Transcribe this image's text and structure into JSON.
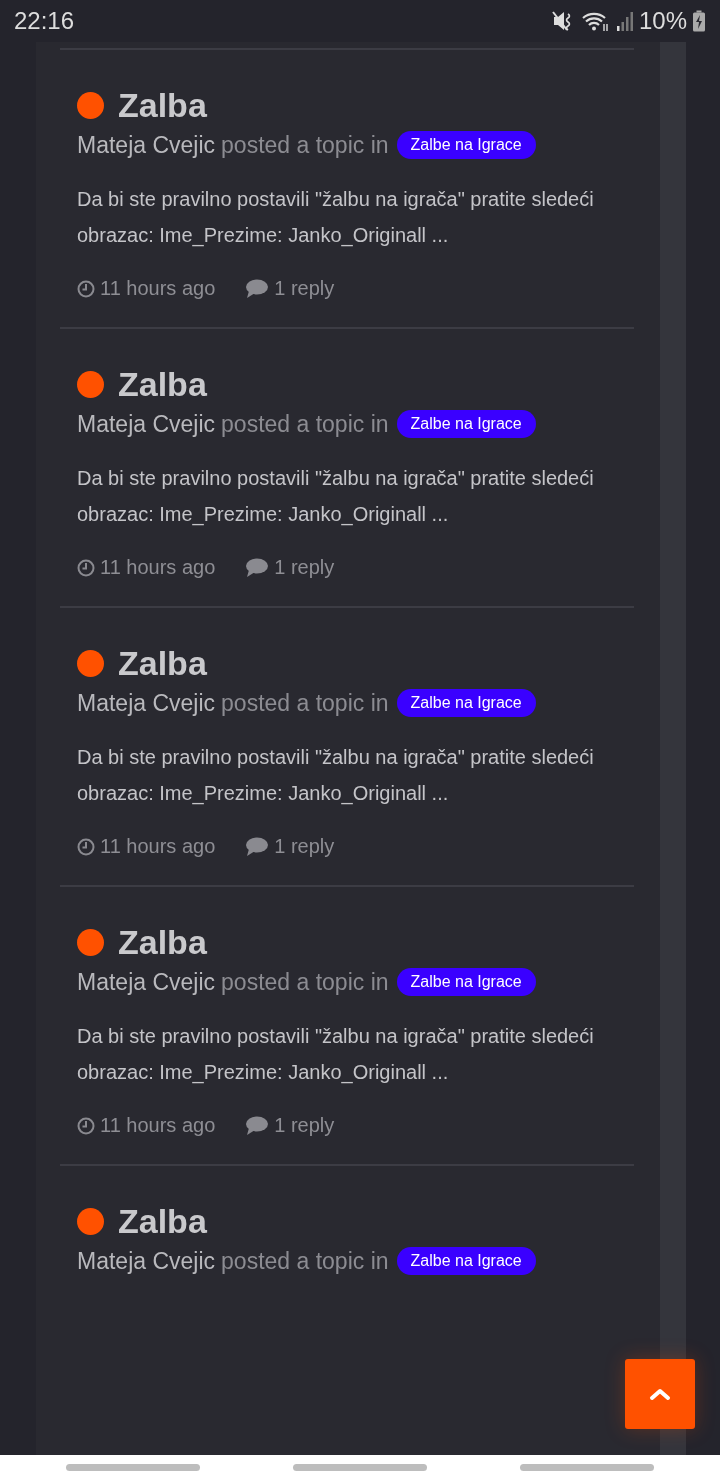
{
  "status_bar": {
    "time": "22:16",
    "battery": "10%"
  },
  "topics": [
    {
      "unread": true,
      "title": "Zalba",
      "author": "Mateja Cvejic",
      "action": "posted a topic in",
      "forum": "Zalbe na Igrace",
      "excerpt": "Da bi ste pravilno postavili \"žalbu na igrača\" pratite sledeći obrazac: Ime_Prezime: Janko_Originall ...",
      "time": "11 hours ago",
      "replies": "1 reply"
    },
    {
      "unread": true,
      "title": "Zalba",
      "author": "Mateja Cvejic",
      "action": "posted a topic in",
      "forum": "Zalbe na Igrace",
      "excerpt": "Da bi ste pravilno postavili \"žalbu na igrača\" pratite sledeći obrazac: Ime_Prezime: Janko_Originall ...",
      "time": "11 hours ago",
      "replies": "1 reply"
    },
    {
      "unread": true,
      "title": "Zalba",
      "author": "Mateja Cvejic",
      "action": "posted a topic in",
      "forum": "Zalbe na Igrace",
      "excerpt": "Da bi ste pravilno postavili \"žalbu na igrača\" pratite sledeći obrazac: Ime_Prezime: Janko_Originall ...",
      "time": "11 hours ago",
      "replies": "1 reply"
    },
    {
      "unread": true,
      "title": "Zalba",
      "author": "Mateja Cvejic",
      "action": "posted a topic in",
      "forum": "Zalbe na Igrace",
      "excerpt": "Da bi ste pravilno postavili \"žalbu na igrača\" pratite sledeći obrazac: Ime_Prezime: Janko_Originall ...",
      "time": "11 hours ago",
      "replies": "1 reply"
    },
    {
      "unread": true,
      "title": "Zalba",
      "author": "Mateja Cvejic",
      "action": "posted a topic in",
      "forum": "Zalbe na Igrace"
    }
  ]
}
